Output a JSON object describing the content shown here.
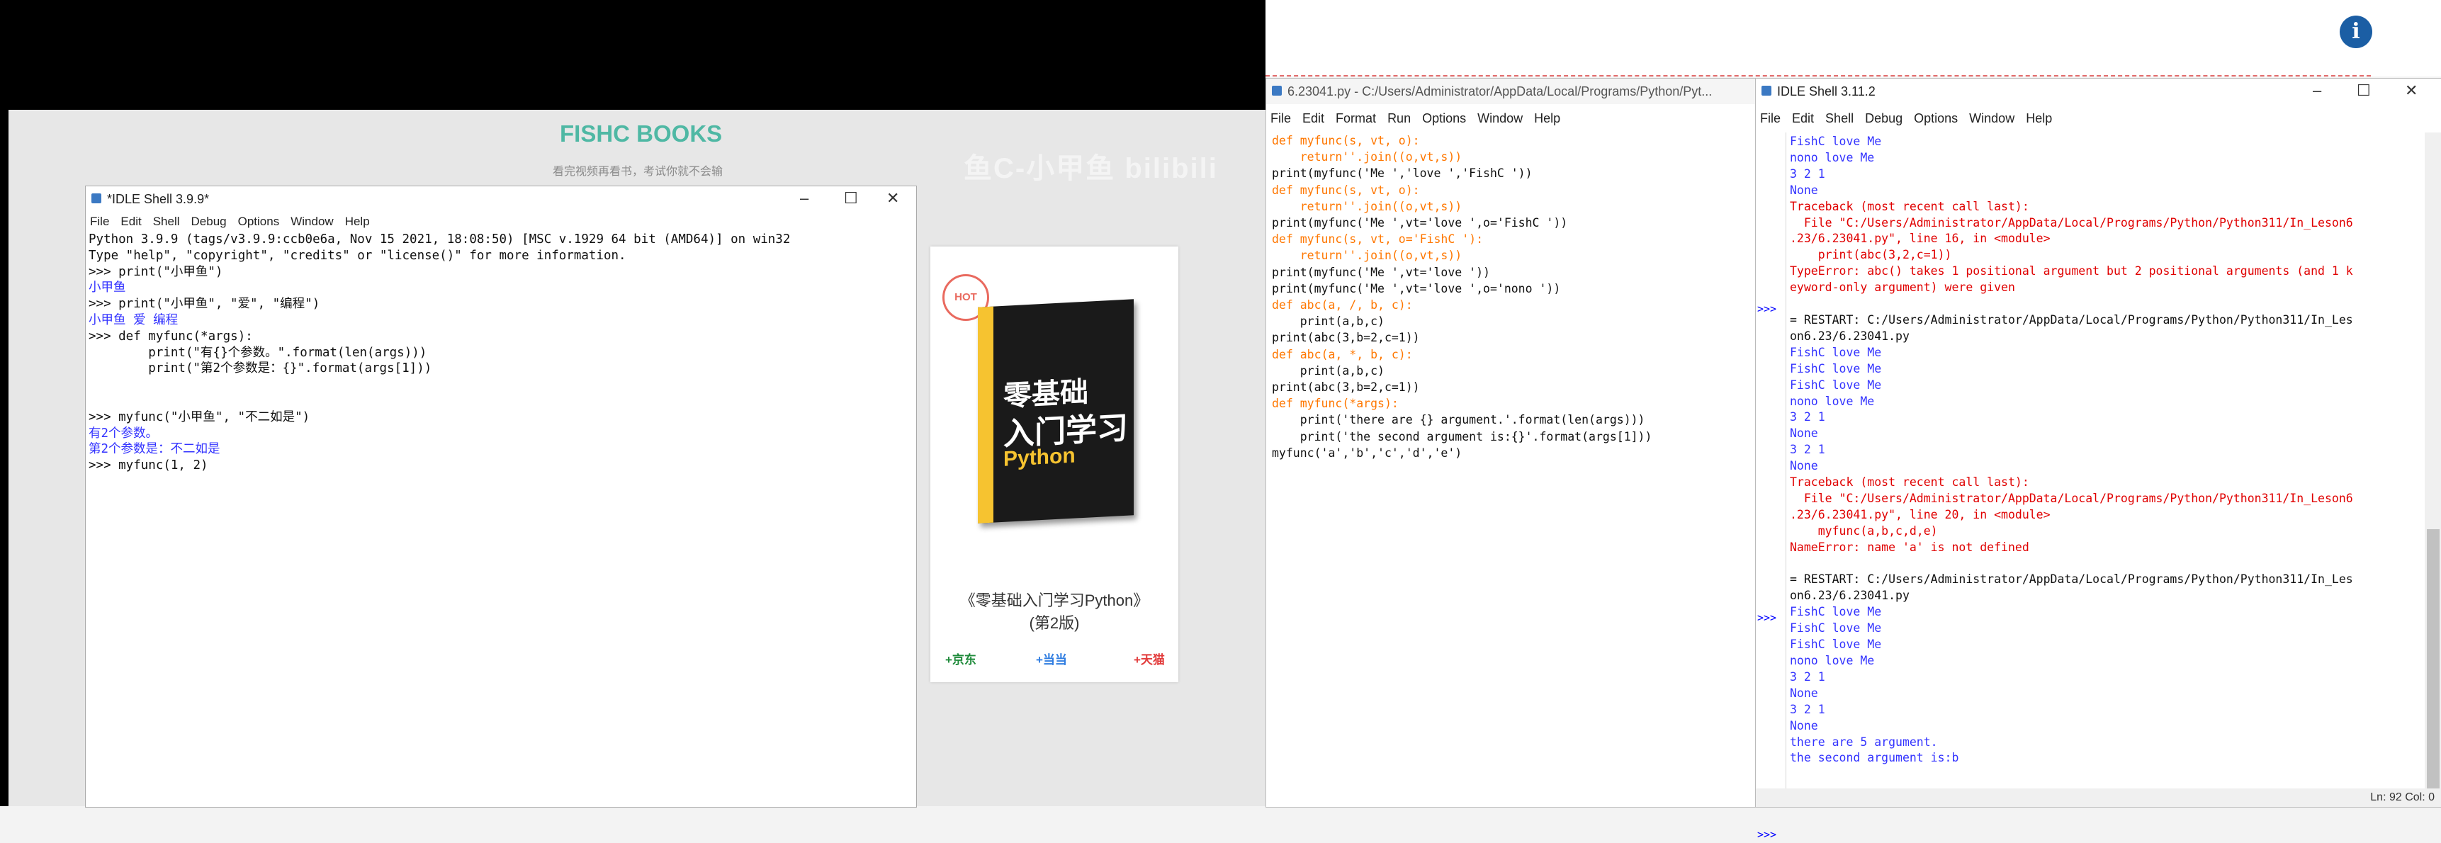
{
  "slide": {
    "title": "FISHC BOOKS",
    "subtitle": "看完视频再看书，考试你就不会输",
    "watermark": "鱼C-小甲鱼 bilibili"
  },
  "idle39": {
    "title": "*IDLE Shell 3.9.9*",
    "menu": [
      "File",
      "Edit",
      "Shell",
      "Debug",
      "Options",
      "Window",
      "Help"
    ],
    "lines": [
      "Python 3.9.9 (tags/v3.9.9:ccb0e6a, Nov 15 2021, 18:08:50) [MSC v.1929 64 bit (AMD64)] on win32",
      "Type \"help\", \"copyright\", \"credits\" or \"license()\" for more information.",
      ">>> print(\"小甲鱼\")",
      "小甲鱼",
      ">>> print(\"小甲鱼\", \"爱\", \"编程\")",
      "小甲鱼 爱 编程",
      ">>> def myfunc(*args):",
      "        print(\"有{}个参数。\".format(len(args)))",
      "        print(\"第2个参数是：{}\".format(args[1]))",
      "",
      "",
      ">>> myfunc(\"小甲鱼\", \"不二如是\")",
      "有2个参数。",
      "第2个参数是：不二如是",
      ">>> myfunc(1, 2)"
    ]
  },
  "book": {
    "badge": "HOT",
    "cover_line1": "零基础",
    "cover_line2": "入门学习",
    "cover_line3": "Python",
    "title_line1": "《零基础入门学习Python》",
    "title_line2": "(第2版)",
    "shops": [
      "+京东",
      "+当当",
      "+天猫"
    ]
  },
  "editor": {
    "title": "6.23041.py - C:/Users/Administrator/AppData/Local/Programs/Python/Pyt...",
    "menu": [
      "File",
      "Edit",
      "Format",
      "Run",
      "Options",
      "Window",
      "Help"
    ],
    "lines": [
      "def myfunc(s, vt, o):",
      "    return''.join((o,vt,s))",
      "print(myfunc('Me ','love ','FishC '))",
      "def myfunc(s, vt, o):",
      "    return''.join((o,vt,s))",
      "print(myfunc('Me ',vt='love ',o='FishC '))",
      "def myfunc(s, vt, o='FishC '):",
      "    return''.join((o,vt,s))",
      "print(myfunc('Me ',vt='love '))",
      "print(myfunc('Me ',vt='love ',o='nono '))",
      "def abc(a, /, b, c):",
      "    print(a,b,c)",
      "print(abc(3,b=2,c=1))",
      "def abc(a, *, b, c):",
      "    print(a,b,c)",
      "print(abc(3,b=2,c=1))",
      "def myfunc(*args):",
      "    print('there are {} argument.'.format(len(args)))",
      "    print('the second argument is:{}'.format(args[1]))",
      "myfunc('a','b','c','d','e')"
    ]
  },
  "shell311": {
    "title": "IDLE Shell 3.11.2",
    "menu": [
      "File",
      "Edit",
      "Shell",
      "Debug",
      "Options",
      "Window",
      "Help"
    ],
    "status": "Ln: 92  Col: 0",
    "lines": [
      {
        "t": "FishC love Me",
        "c": "o"
      },
      {
        "t": "nono love Me",
        "c": "o"
      },
      {
        "t": "3 2 1",
        "c": "o"
      },
      {
        "t": "None",
        "c": "o"
      },
      {
        "t": "Traceback (most recent call last):",
        "c": "r"
      },
      {
        "t": "  File \"C:/Users/Administrator/AppData/Local/Programs/Python/Python311/In_Leson6",
        "c": "r"
      },
      {
        "t": ".23/6.23041.py\", line 16, in <module>",
        "c": "r"
      },
      {
        "t": "    print(abc(3,2,c=1))",
        "c": "r"
      },
      {
        "t": "TypeError: abc() takes 1 positional argument but 2 positional arguments (and 1 k",
        "c": "r"
      },
      {
        "t": "eyword-only argument) were given",
        "c": "r"
      },
      {
        "t": "",
        "c": "bk"
      },
      {
        "t": "= RESTART: C:/Users/Administrator/AppData/Local/Programs/Python/Python311/In_Les",
        "c": "bk"
      },
      {
        "t": "on6.23/6.23041.py",
        "c": "bk"
      },
      {
        "t": "FishC love Me",
        "c": "o"
      },
      {
        "t": "FishC love Me",
        "c": "o"
      },
      {
        "t": "FishC love Me",
        "c": "o"
      },
      {
        "t": "nono love Me",
        "c": "o"
      },
      {
        "t": "3 2 1",
        "c": "o"
      },
      {
        "t": "None",
        "c": "o"
      },
      {
        "t": "3 2 1",
        "c": "o"
      },
      {
        "t": "None",
        "c": "o"
      },
      {
        "t": "Traceback (most recent call last):",
        "c": "r"
      },
      {
        "t": "  File \"C:/Users/Administrator/AppData/Local/Programs/Python/Python311/In_Leson6",
        "c": "r"
      },
      {
        "t": ".23/6.23041.py\", line 20, in <module>",
        "c": "r"
      },
      {
        "t": "    myfunc(a,b,c,d,e)",
        "c": "r"
      },
      {
        "t": "NameError: name 'a' is not defined",
        "c": "r"
      },
      {
        "t": "",
        "c": "bk"
      },
      {
        "t": "= RESTART: C:/Users/Administrator/AppData/Local/Programs/Python/Python311/In_Les",
        "c": "bk"
      },
      {
        "t": "on6.23/6.23041.py",
        "c": "bk"
      },
      {
        "t": "FishC love Me",
        "c": "o"
      },
      {
        "t": "FishC love Me",
        "c": "o"
      },
      {
        "t": "FishC love Me",
        "c": "o"
      },
      {
        "t": "nono love Me",
        "c": "o"
      },
      {
        "t": "3 2 1",
        "c": "o"
      },
      {
        "t": "None",
        "c": "o"
      },
      {
        "t": "3 2 1",
        "c": "o"
      },
      {
        "t": "None",
        "c": "o"
      },
      {
        "t": "there are 5 argument.",
        "c": "o"
      },
      {
        "t": "the second argument is:b",
        "c": "o"
      }
    ],
    "prompts": [
      ">>>",
      ">>>",
      ">>>"
    ]
  },
  "info_icon": "i"
}
